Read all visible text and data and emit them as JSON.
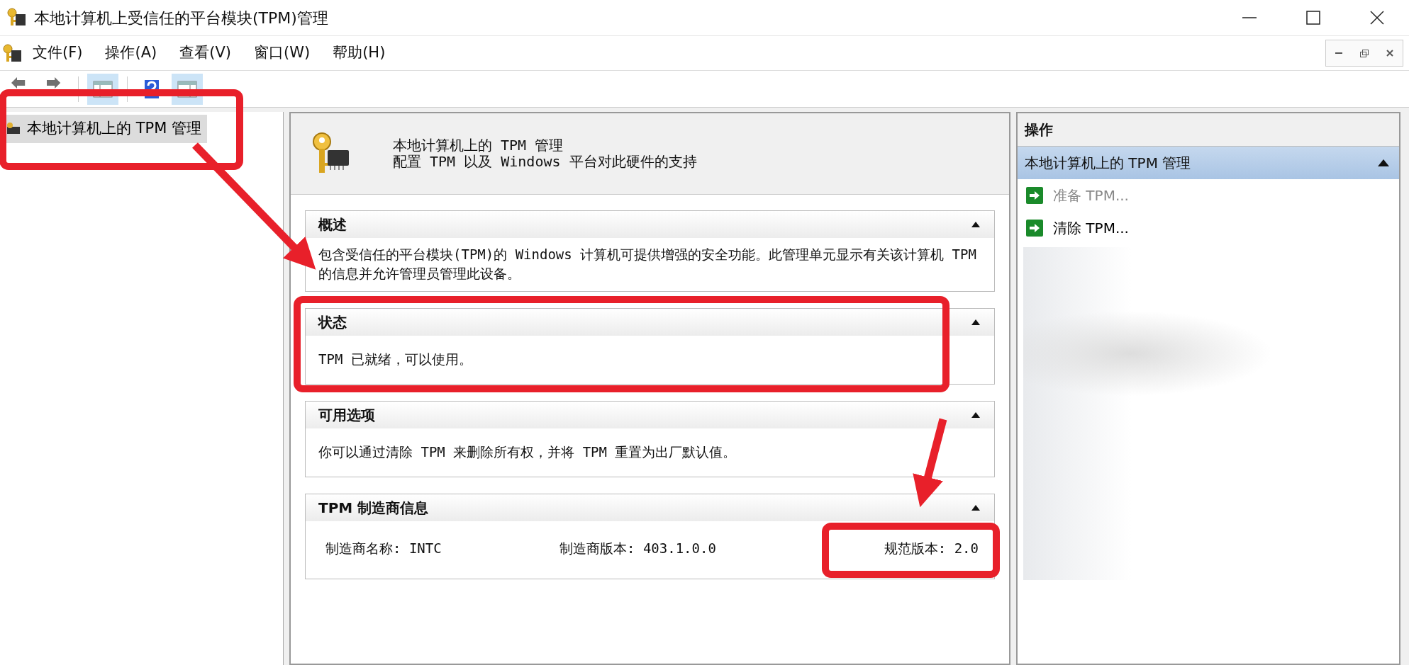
{
  "window": {
    "title": "本地计算机上受信任的平台模块(TPM)管理"
  },
  "menu": [
    {
      "label": "文件(F)"
    },
    {
      "label": "操作(A)"
    },
    {
      "label": "查看(V)"
    },
    {
      "label": "窗口(W)"
    },
    {
      "label": "帮助(H)"
    }
  ],
  "toolbar": [
    {
      "kind": "back",
      "disabled": true,
      "selected": false
    },
    {
      "kind": "forward",
      "disabled": true,
      "selected": false
    },
    {
      "kind": "tree",
      "disabled": false,
      "selected": true
    },
    {
      "kind": "help",
      "disabled": false,
      "selected": false
    },
    {
      "kind": "pane",
      "disabled": false,
      "selected": true
    }
  ],
  "tree": [
    {
      "label": "本地计算机上的 TPM 管理",
      "selected": true
    }
  ],
  "header": {
    "title": "本地计算机上的 TPM 管理",
    "subtitle": "配置 TPM 以及 Windows 平台对此硬件的支持"
  },
  "sections": [
    {
      "title": "概述",
      "expanded": true,
      "kind": "text",
      "text": "包含受信任的平台模块(TPM)的 Windows 计算机可提供增强的安全功能。此管理单元显示有关该计算机 TPM 的信息并允许管理员管理此设备。"
    },
    {
      "title": "状态",
      "expanded": true,
      "kind": "text",
      "text": "TPM 已就绪，可以使用。"
    },
    {
      "title": "可用选项",
      "expanded": true,
      "kind": "text",
      "text": "你可以通过清除 TPM 来删除所有权，并将 TPM 重置为出厂默认值。"
    },
    {
      "title": "TPM 制造商信息",
      "expanded": true,
      "kind": "fields",
      "fields": [
        "制造商名称: INTC",
        "制造商版本: 403.1.0.0",
        "规范版本: 2.0"
      ]
    }
  ],
  "actions": {
    "title": "操作",
    "group": {
      "label": "本地计算机上的 TPM 管理",
      "expanded": true
    },
    "items": [
      {
        "label": "准备 TPM...",
        "disabled": true
      },
      {
        "label": "清除 TPM...",
        "disabled": false
      }
    ]
  }
}
